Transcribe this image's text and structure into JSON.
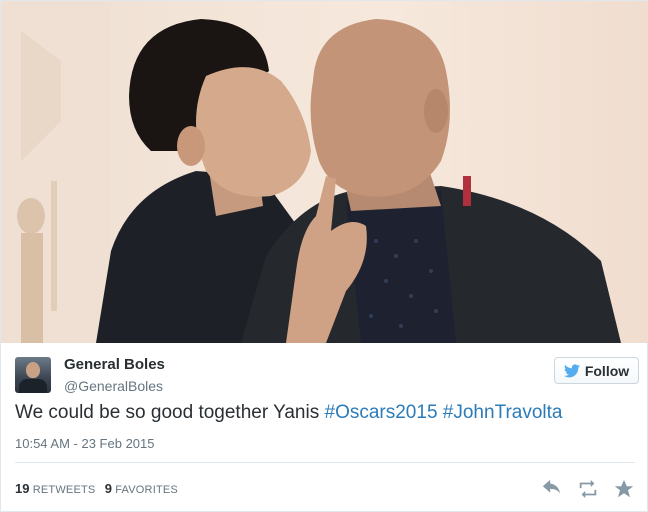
{
  "tweet": {
    "display_name": "General Boles",
    "username": "@GeneralBoles",
    "text_plain": "We could be so good together Yanis ",
    "hashtags": [
      "#Oscars2015",
      "#JohnTravolta"
    ],
    "timestamp": "10:54 AM - 23 Feb 2015",
    "follow_label": "Follow",
    "stats": {
      "retweets_count": "19",
      "retweets_label": "RETWEETS",
      "favorites_count": "9",
      "favorites_label": "FAVORITES"
    }
  },
  "icons": {
    "follow": "twitter-bird-icon",
    "reply": "reply-icon",
    "retweet": "retweet-icon",
    "favorite": "star-icon"
  },
  "colors": {
    "hashtag": "#2b7bb9",
    "twitter_blue": "#55acee",
    "action_icon": "#8899a6"
  }
}
